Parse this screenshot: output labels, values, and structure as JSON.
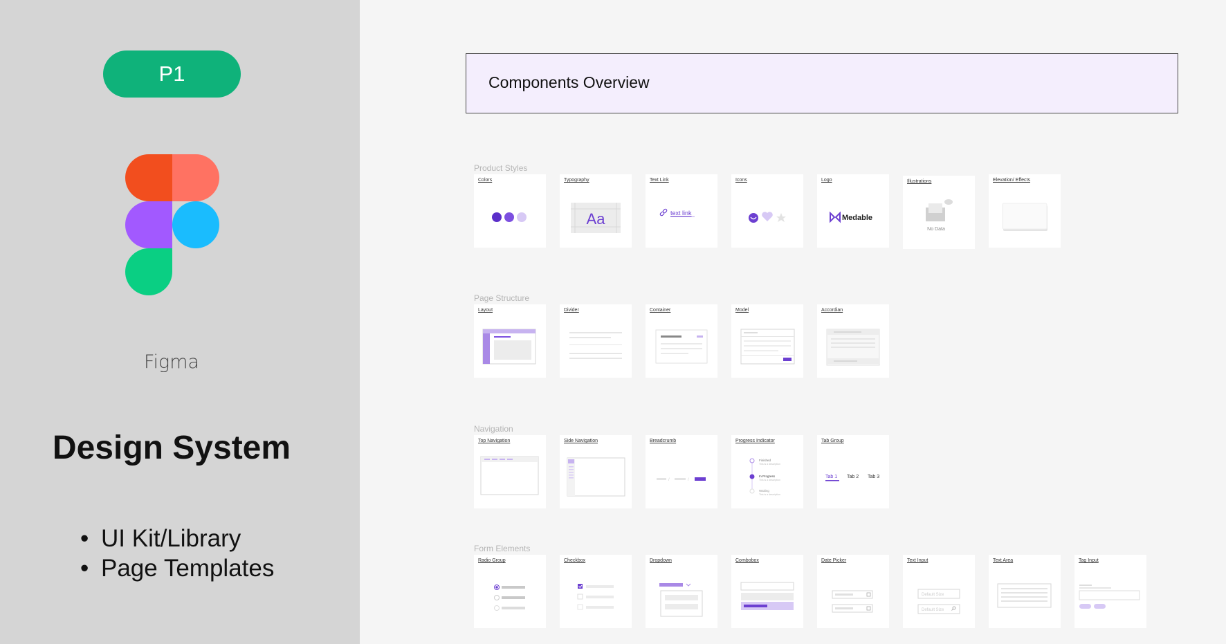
{
  "left": {
    "badge": "P1",
    "app_name": "Figma",
    "title": "Design System",
    "bullets": [
      "UI Kit/Library",
      "Page Templates"
    ]
  },
  "overview": {
    "title": "Components Overview"
  },
  "sections": [
    {
      "title": "Product Styles",
      "cards": [
        "Colors",
        "Typography",
        "Text Link",
        "Icons",
        "Logo",
        "Illustrations",
        "Elevation/ Effects"
      ]
    },
    {
      "title": "Page Structure",
      "cards": [
        "Layout",
        "Divider",
        "Container",
        "Model",
        "Accordian"
      ]
    },
    {
      "title": "Navigation",
      "cards": [
        "Top Navigation",
        "Side Navigation",
        "Breadcrumb",
        "Progress Indicator",
        "Tab Group"
      ]
    },
    {
      "title": "Form Elements",
      "cards": [
        "Radio Group",
        "Checkbox",
        "Dropdown",
        "Combobox",
        "Date Picker",
        "Text Input",
        "Text Area",
        "Tag Input"
      ]
    }
  ],
  "previews": {
    "typography": "Aa",
    "text_link": "text link",
    "logo": "Medable",
    "illustration_caption": "No Data",
    "progress_steps": [
      "Finished",
      "In Progress",
      "Waiting"
    ],
    "progress_desc": "This is a description",
    "tabs": [
      "Tab 1",
      "Tab 2",
      "Tab 3"
    ],
    "input_placeholder": "Default Size"
  },
  "colors": {
    "accent": "#6c3fd1",
    "accent_light": "#d7c9f5",
    "badge_green": "#0fb27a"
  }
}
